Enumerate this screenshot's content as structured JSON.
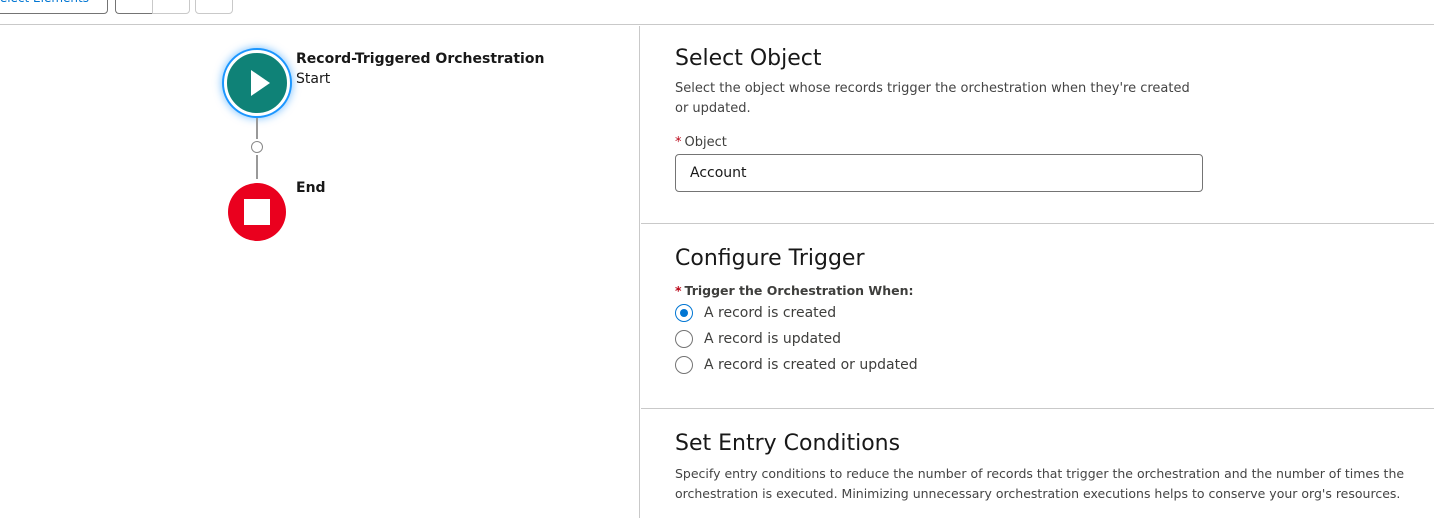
{
  "toolbar": {
    "select_elements_label": "Select Elements"
  },
  "canvas": {
    "start": {
      "title": "Record-Triggered Orchestration",
      "subtitle": "Start"
    },
    "end": {
      "title": "End"
    }
  },
  "panel": {
    "select_object": {
      "heading": "Select Object",
      "description": "Select the object whose records trigger the orchestration when they're created or updated.",
      "field_label": "Object",
      "field_value": "Account"
    },
    "configure_trigger": {
      "heading": "Configure Trigger",
      "field_label": "Trigger the Orchestration When:",
      "options": [
        {
          "label": "A record is created",
          "selected": true
        },
        {
          "label": "A record is updated",
          "selected": false
        },
        {
          "label": "A record is created or updated",
          "selected": false
        }
      ]
    },
    "entry_conditions": {
      "heading": "Set Entry Conditions",
      "description": "Specify entry conditions to reduce the number of records that trigger the orchestration and the number of times the orchestration is executed. Minimizing unnecessary orchestration executions helps to conserve your org's resources."
    }
  },
  "colors": {
    "start": "#0f8277",
    "end": "#ea001e",
    "accent": "#0176d3"
  }
}
